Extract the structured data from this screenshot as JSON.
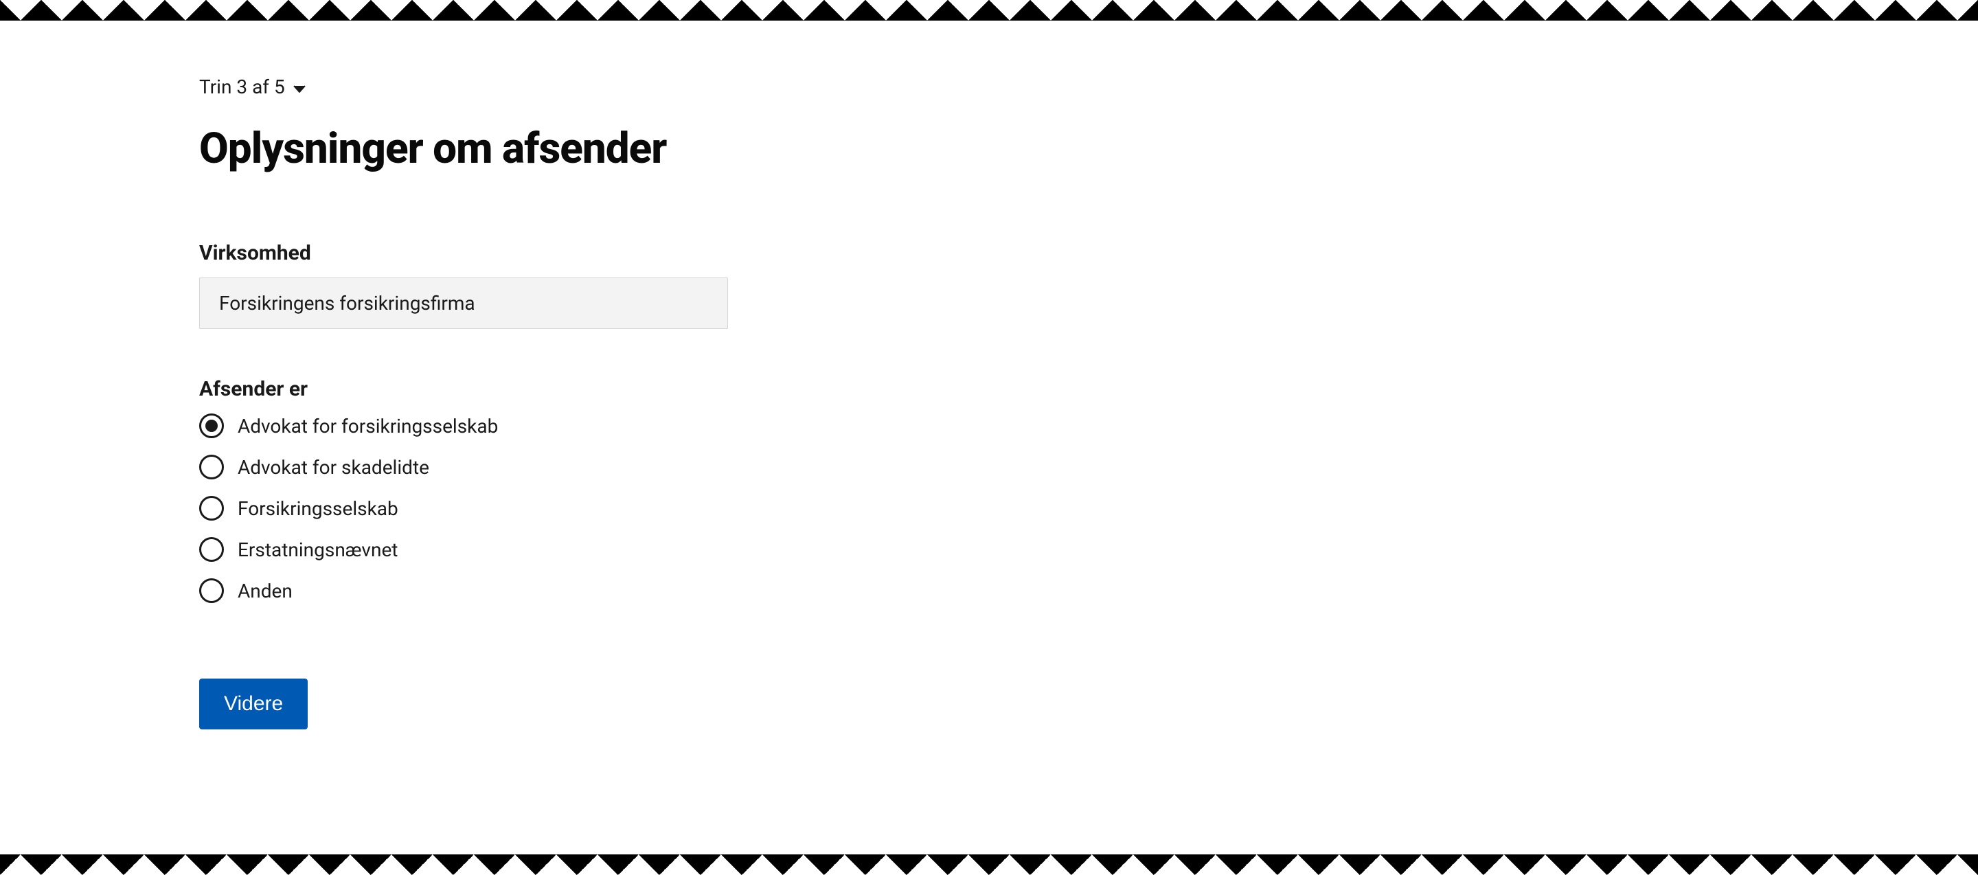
{
  "step": {
    "label": "Trin 3 af 5"
  },
  "title": "Oplysninger om afsender",
  "company": {
    "label": "Virksomhed",
    "value": "Forsikringens forsikringsfirma"
  },
  "sender": {
    "label": "Afsender er",
    "options": [
      {
        "label": "Advokat for forsikringsselskab",
        "selected": true
      },
      {
        "label": "Advokat for skadelidte",
        "selected": false
      },
      {
        "label": "Forsikringsselskab",
        "selected": false
      },
      {
        "label": "Erstatningsnævnet",
        "selected": false
      },
      {
        "label": "Anden",
        "selected": false
      }
    ]
  },
  "actions": {
    "next": "Videre"
  }
}
